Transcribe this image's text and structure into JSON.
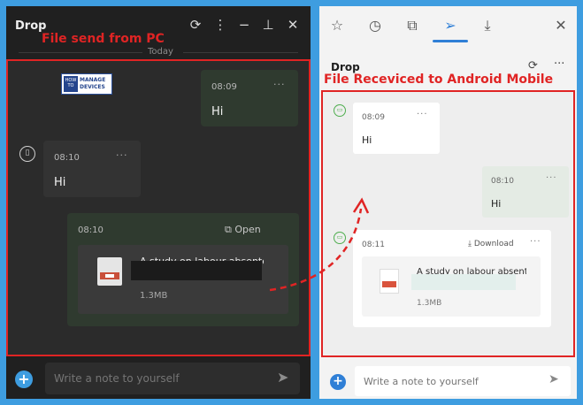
{
  "left_window": {
    "title": "Drop",
    "today_label": "Today",
    "messages": [
      {
        "time": "08:09",
        "text": "Hi",
        "dots": "···"
      },
      {
        "time": "08:10",
        "text": "Hi",
        "dots": "···"
      }
    ],
    "file": {
      "time": "08:10",
      "open_label": "Open",
      "name": "A study on labour absenteeism in Highland",
      "size": "1.3MB"
    },
    "logo": {
      "how": "HOW TO",
      "text": "MANAGE DEVICES"
    },
    "input_placeholder": "Write a note to yourself",
    "icons": [
      "sync-icon",
      "more-icon",
      "minimize-icon",
      "pin-icon",
      "close-icon"
    ]
  },
  "right_window": {
    "tabs": [
      "star-icon",
      "history-icon",
      "collections-icon",
      "drop-send-icon",
      "download-icon"
    ],
    "title": "Drop",
    "messages": [
      {
        "time": "08:09",
        "text": "Hi",
        "dots": "···"
      },
      {
        "time": "08:10",
        "text": "Hi",
        "dots": "···"
      }
    ],
    "file": {
      "time": "08:11",
      "download_label": "Download",
      "name": "A study on labour absenteeism in Highland",
      "size": "1.3MB"
    },
    "input_placeholder": "Write a note to yourself"
  },
  "annotations": {
    "left": "File send from PC",
    "right": "File Receviced to Android Mobile"
  },
  "colors": {
    "accent_blue": "#3e9de0",
    "annotation_red": "#e02424",
    "background": "#3e9de0"
  }
}
